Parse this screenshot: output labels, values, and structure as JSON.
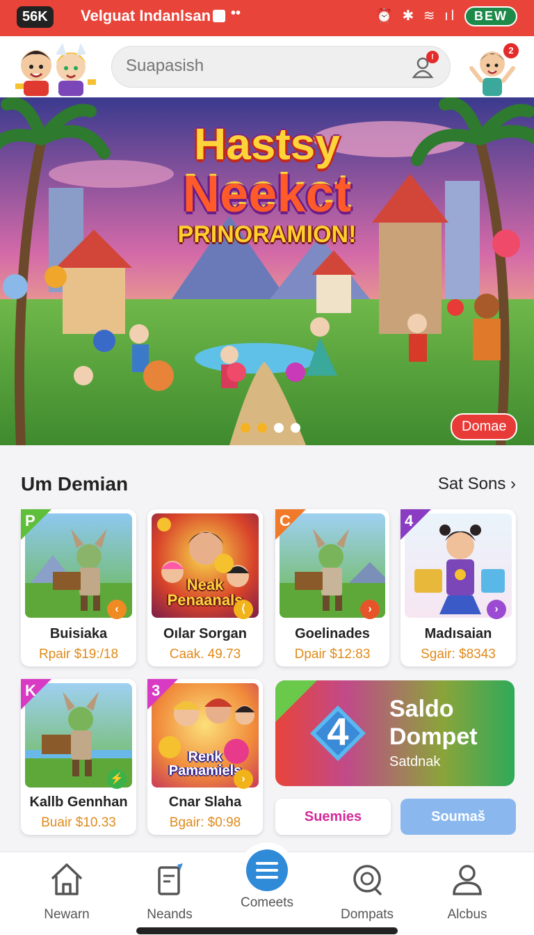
{
  "status_bar": {
    "signal": "56K",
    "title": "Velguat Indanlsan",
    "dots": "••",
    "icons": "⏰ ✱ ≋ ıl ⚡",
    "battery": "BEW"
  },
  "search": {
    "placeholder": "Suapasish",
    "user_badge": "!",
    "avatar_badge": "2"
  },
  "banner": {
    "title_line1": "Hastsy",
    "title_line2": "Neekct",
    "title_line3": "PRINORAMION!",
    "cta": "Domae",
    "dot_colors": [
      "#f5b323",
      "#f5b323",
      "#ffffff",
      "#ffffff"
    ]
  },
  "section": {
    "title": "Um Demian",
    "see_all": "Sat Sons"
  },
  "games": [
    {
      "name": "Buisiaka",
      "price": "Rpair $19:/18",
      "tag": "P",
      "tag_color": "#5fbe3a",
      "btn_color": "#f08a22",
      "btn": "‹"
    },
    {
      "name": "Oılar Sorgan",
      "price": "Caak. 49.73",
      "tag": "",
      "tag_color": "",
      "btn_color": "#f2b21a",
      "btn": "⟨",
      "art_text": "Neak Penaanals"
    },
    {
      "name": "Goelinades",
      "price": "Dpair $12:83",
      "tag": "C",
      "tag_color": "#f07a2a",
      "btn_color": "#e8542a",
      "btn": "›"
    },
    {
      "name": "Madısaian",
      "price": "Sgair: $8343",
      "tag": "4",
      "tag_color": "#8a3cc2",
      "btn_color": "#9b4ad2",
      "btn": "›"
    },
    {
      "name": "Kallb Gennhan",
      "price": "Buair $10.33",
      "tag": "K",
      "tag_color": "#d83ac4",
      "btn_color": "#3ab24a",
      "btn": "⚡"
    },
    {
      "name": "Cnar Slaha",
      "price": "Bgair: $0:98",
      "tag": "3",
      "tag_color": "#d83ac4",
      "btn_color": "#f2b21a",
      "btn": "›",
      "art_text": "Renk Pamamiels"
    }
  ],
  "saldo": {
    "number": "4",
    "line1": "Saldo",
    "line2": "Dompet",
    "sub": "Satdnak"
  },
  "chips": {
    "left": "Suemies",
    "right": "Soumaš"
  },
  "nav": [
    {
      "label": "Newarn",
      "icon": "home-icon"
    },
    {
      "label": "Neands",
      "icon": "document-icon"
    },
    {
      "label": "Comeets",
      "icon": "menu-icon"
    },
    {
      "label": "Dompats",
      "icon": "chat-icon"
    },
    {
      "label": "Alcbus",
      "icon": "profile-icon"
    }
  ]
}
